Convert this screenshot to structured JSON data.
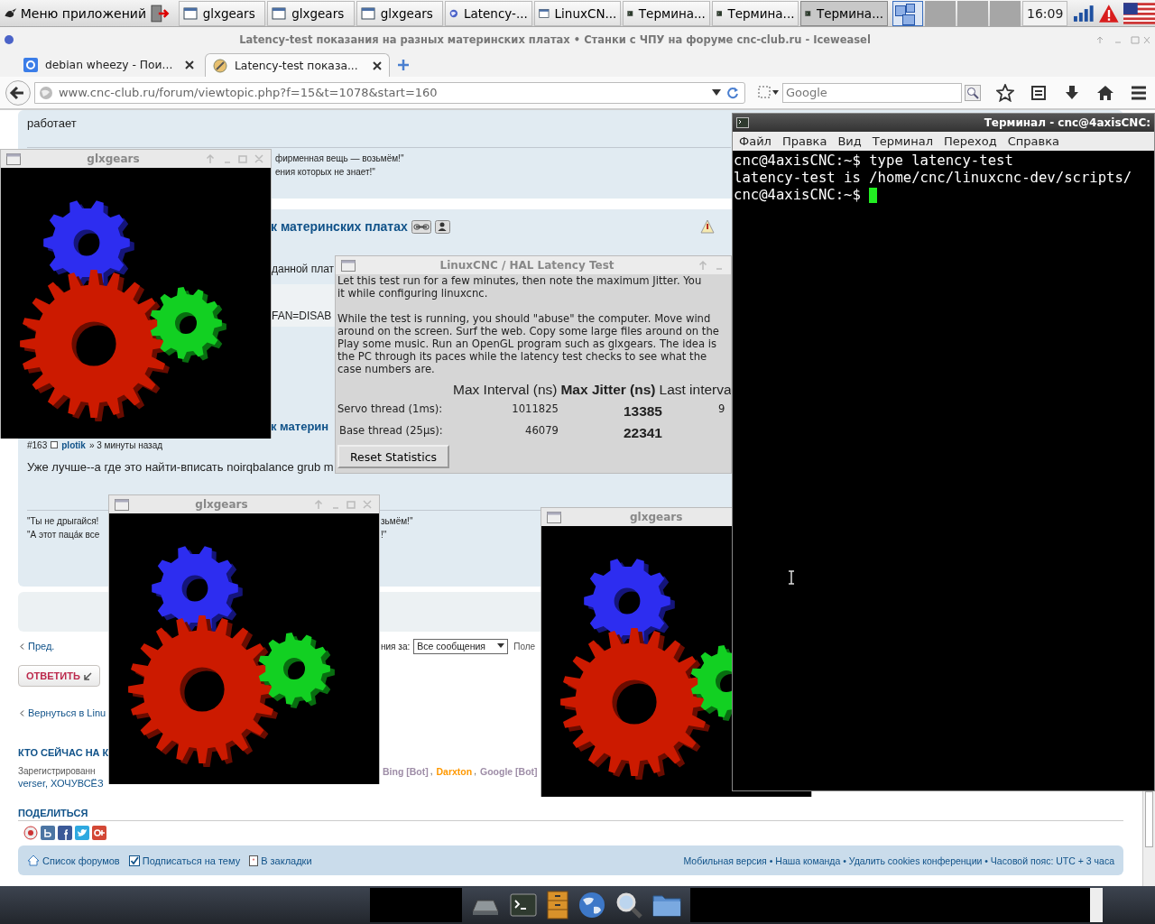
{
  "taskbar": {
    "app_menu": "Меню приложений",
    "tasks": [
      {
        "label": "glxgears",
        "kind": "window",
        "selected": false
      },
      {
        "label": "glxgears",
        "kind": "window",
        "selected": false
      },
      {
        "label": "glxgears",
        "kind": "window",
        "selected": false
      },
      {
        "label": "Latency-...",
        "kind": "globe",
        "selected": false
      },
      {
        "label": "LinuxCN...",
        "kind": "window",
        "selected": false
      },
      {
        "label": "Термина...",
        "kind": "terminal",
        "selected": false
      },
      {
        "label": "Термина...",
        "kind": "terminal",
        "selected": false
      },
      {
        "label": "Термина...",
        "kind": "terminal",
        "selected": true
      }
    ],
    "desktops": [
      {
        "selected": true
      },
      {
        "selected": false
      },
      {
        "selected": false
      },
      {
        "selected": false
      }
    ],
    "clock": "16:09"
  },
  "browser": {
    "title": "Latency-test показания на разных материнских платах • Станки с ЧПУ на форуме cnc-club.ru - Iceweasel",
    "tabs": [
      {
        "label": "debian wheezy - Пои...",
        "kind": "google",
        "selected": false
      },
      {
        "label": "Latency-test показа...",
        "kind": "forum",
        "selected": true
      }
    ],
    "address": "www.cnc-club.ru/forum/viewtopic.php?f=15&t=1078&start=160",
    "search_placeholder": "Google"
  },
  "forum": {
    "post_top": {
      "body": "работает",
      "quote_lines": [
        "фирменная вещь — возьмём!\"",
        "ения которых не знает!\""
      ]
    },
    "post": {
      "title": "к материнских платах",
      "line_1": "данной плат",
      "code_fragment": "FAN=DISAB",
      "title_2": "к материн",
      "number": "#163",
      "author": "plotik",
      "time": "» 3 минуты назад",
      "body": "Уже лучше--а где это найти-вписать noirqbalance grub m",
      "signature": [
        {
          "left": "\"Ты не дрыгайся!",
          "right": "зьмём!\""
        },
        {
          "left": "\"А этот пацáк все",
          "right": "!\""
        }
      ]
    },
    "nav": {
      "prev": "Пред.",
      "sort_label": "ния за:",
      "sort_value": "Все сообщения",
      "field_fragment": "Поле",
      "reply": "ОТВЕТИТЬ",
      "back": "Вернуться в Linu"
    },
    "online": {
      "heading": "КТО СЕЙЧАС НА К",
      "registered": "Зарегистрированн",
      "separator": ",",
      "users": [
        {
          "name": "Bing [Bot]",
          "color": "#9e8da7"
        },
        {
          "name": "Darxton",
          "color": "#ff9900"
        },
        {
          "name": "Google [Bot]",
          "color": "#9e8da7"
        }
      ],
      "line_2": "verser, ХОЧУВСЁЗ"
    },
    "share": {
      "heading": "ПОДЕЛИТЬСЯ"
    },
    "footer": {
      "left": [
        "Список форумов",
        "Подписаться на тему",
        "В закладки"
      ],
      "right": "Мобильная версия • Наша команда • Удалить cookies конференции • Часовой пояс: UTC + 3 часа"
    }
  },
  "glxgears": [
    {
      "title": "glxgears"
    },
    {
      "title": "glxgears"
    },
    {
      "title": "glxgears"
    }
  ],
  "latency": {
    "title": "LinuxCNC / HAL Latency Test",
    "paragraphs": [
      [
        "Let this test run for a few minutes, then note the maximum Jitter.  You",
        "it while configuring linuxcnc."
      ],
      [
        "While the test is running, you should \"abuse\" the computer. Move wind",
        "around on the screen. Surf the web. Copy some large files around on the",
        "Play some music. Run an OpenGL program such as glxgears. The idea is",
        "the PC through its paces while the latency test checks to see what the",
        "case numbers are."
      ]
    ],
    "columns": [
      "Max Interval (ns)",
      "Max Jitter (ns)",
      "Last interva"
    ],
    "rows": [
      {
        "label": "Servo thread (1ms):",
        "max_interval": "1011825",
        "max_jitter": "13385",
        "last": "9"
      },
      {
        "label": "Base thread (25µs):",
        "max_interval": "46079",
        "max_jitter": "22341"
      }
    ],
    "button": "Reset Statistics"
  },
  "terminal": {
    "title": "Терминал - cnc@4axisCNC:",
    "menu": [
      "Файл",
      "Правка",
      "Вид",
      "Терминал",
      "Переход",
      "Справка"
    ],
    "lines": [
      "cnc@4axisCNC:~$ type latency-test",
      "latency-test is /home/cnc/linuxcnc-dev/scripts/",
      "cnc@4axisCNC:~$ "
    ]
  }
}
